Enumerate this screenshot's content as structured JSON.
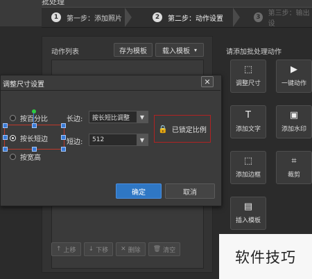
{
  "app": {
    "title": "批处理"
  },
  "steps": [
    {
      "num": "1",
      "label": "第一步：添加照片"
    },
    {
      "num": "2",
      "label": "第二步：动作设置"
    },
    {
      "num": "3",
      "label": "第三步：输出设"
    }
  ],
  "left_panel": {
    "label": "动作列表",
    "save_template": "存为模板",
    "load_template": "载入模板",
    "bottom_buttons": [
      {
        "icon": "↑",
        "label": "上移"
      },
      {
        "icon": "↓",
        "label": "下移"
      },
      {
        "icon": "✕",
        "label": "删除"
      },
      {
        "icon": "🗑",
        "label": "清空"
      }
    ]
  },
  "right_panel": {
    "label": "请添加批处理动作",
    "tiles": [
      {
        "icon": "⬚",
        "label": "调整尺寸"
      },
      {
        "icon": "▶",
        "label": "一键动作"
      },
      {
        "icon": "T",
        "label": "添加文字"
      },
      {
        "icon": "▣",
        "label": "添加水印"
      },
      {
        "icon": "⬚",
        "label": "添加边框"
      },
      {
        "icon": "⌗",
        "label": "裁剪"
      },
      {
        "icon": "▤",
        "label": "插入模板"
      }
    ]
  },
  "dialog": {
    "title": "调整尺寸设置",
    "close": "✕",
    "radios": [
      {
        "label": "按百分比",
        "selected": false
      },
      {
        "label": "按长短边",
        "selected": true
      },
      {
        "label": "按宽高",
        "selected": false
      }
    ],
    "long_label": "长边:",
    "long_value": "按长短比调整",
    "short_label": "短边:",
    "short_value": "512",
    "lock_text": "已锁定比例",
    "ok": "确定",
    "cancel": "取消"
  },
  "watermark": "软件技巧",
  "colors": {
    "accent": "#2f77c4",
    "highlight": "#b22222",
    "handle": "#2ecc40"
  }
}
